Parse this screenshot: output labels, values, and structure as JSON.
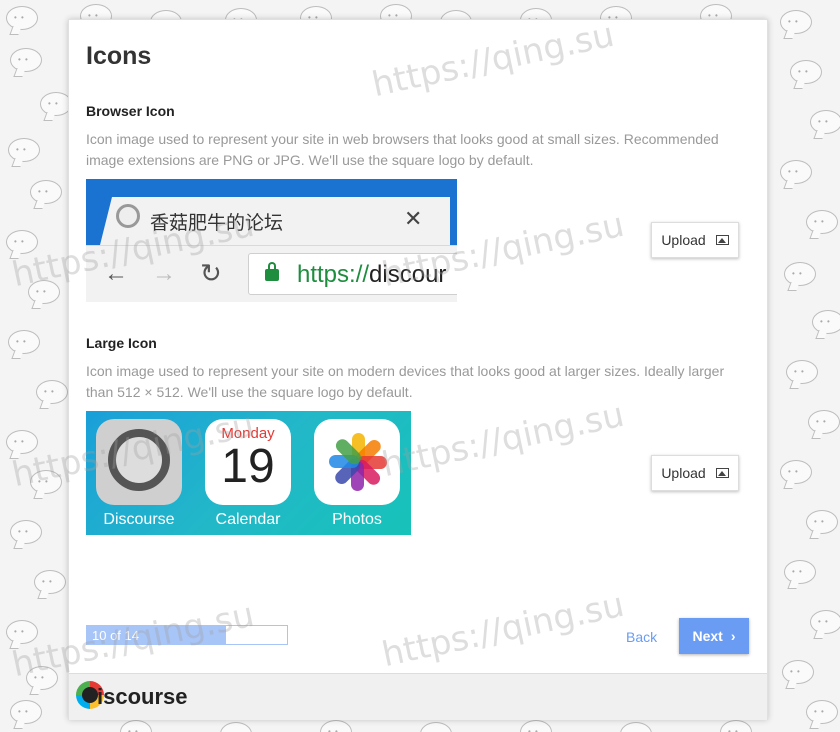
{
  "background": {
    "watermark_text": "https://qing.su"
  },
  "modal": {
    "title": "Icons"
  },
  "browser_icon": {
    "title": "Browser Icon",
    "description": "Icon image used to represent your site in web browsers that looks good at small sizes. Recommended image extensions are PNG or JPG. We'll use the square logo by default.",
    "preview": {
      "tab_title": "香菇肥牛的论坛",
      "url_scheme": "https://",
      "url_host": "discour"
    },
    "upload_label": "Upload"
  },
  "large_icon": {
    "title": "Large Icon",
    "description": "Icon image used to represent your site on modern devices that looks good at larger sizes. Ideally larger than 512 × 512. We'll use the square logo by default.",
    "preview": {
      "apps": [
        {
          "label": "Discourse"
        },
        {
          "label": "Calendar",
          "month": "Monday",
          "day": "19"
        },
        {
          "label": "Photos"
        }
      ]
    },
    "upload_label": "Upload"
  },
  "wizard": {
    "progress_text": "10 of 14",
    "progress_fraction": 0.6931,
    "back_label": "Back",
    "next_label": "Next"
  },
  "footer": {
    "logo_text": "iscourse"
  },
  "colors": {
    "accent": "#6a9cf4",
    "progress_fill": "#a8c5f7",
    "browser_blue": "#1a73d1",
    "secure_green": "#1e8e3e"
  }
}
